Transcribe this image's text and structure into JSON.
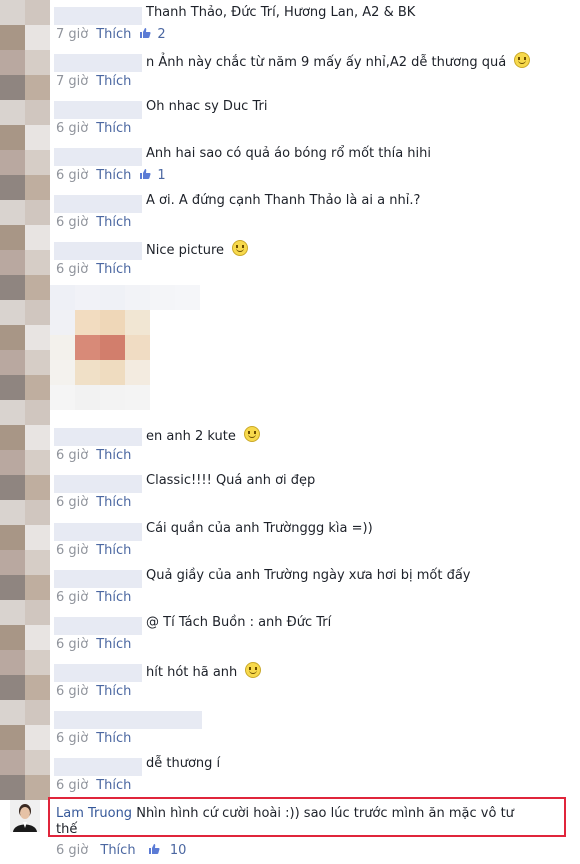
{
  "comments": [
    {
      "text": "Thanh Thảo, Đức Trí, Hương Lan, A2 & BK",
      "time": "7 giờ",
      "like": "Thích",
      "likes": "2"
    },
    {
      "text": "n Ảnh này chắc từ năm 9 mấy ấy nhỉ,A2 dễ thương quá",
      "time": "7 giờ",
      "like": "Thích",
      "likes": ""
    },
    {
      "text": "Oh nhac sy Duc Tri",
      "time": "6 giờ",
      "like": "Thích",
      "likes": ""
    },
    {
      "text": "Anh hai sao có quả áo bóng rổ mốt thía hihi",
      "time": "6 giờ",
      "like": "Thích",
      "likes": "1"
    },
    {
      "text": "A ơi. A đứng cạnh Thanh Thảo là ai a nhỉ.?",
      "time": "6 giờ",
      "like": "Thích",
      "likes": ""
    },
    {
      "text": "Nice picture",
      "time": "6 giờ",
      "like": "Thích",
      "likes": ""
    },
    {
      "text": "en anh 2 kute",
      "time": "6 giờ",
      "like": "Thích",
      "likes": ""
    },
    {
      "text": "Classic!!!! Quá anh ơi đẹp",
      "time": "6 giờ",
      "like": "Thích",
      "likes": ""
    },
    {
      "text": "Cái quần của anh Trườnggg kìa =))",
      "time": "6 giờ",
      "like": "Thích",
      "likes": ""
    },
    {
      "text": "Quả giầy của anh Trường ngày xưa hơi bị mốt đấy",
      "time": "6 giờ",
      "like": "Thích",
      "likes": ""
    },
    {
      "text": "@ Tí Tách Buồn : anh Đức Trí",
      "time": "6 giờ",
      "like": "Thích",
      "likes": ""
    },
    {
      "text": "hít hót hã anh",
      "time": "6 giờ",
      "like": "Thích",
      "likes": ""
    },
    {
      "text": "",
      "time": "6 giờ",
      "like": "Thích",
      "likes": ""
    },
    {
      "text": "dễ thương í",
      "time": "6 giờ",
      "like": "Thích",
      "likes": ""
    }
  ],
  "highlighted": {
    "author": "Lam Truong",
    "text_line1": "Nhìn hình cứ cười hoài :)) sao lúc trước mình ăn mặc vô tư",
    "text_line2": "thế",
    "time": "6 giờ",
    "like": "Thích",
    "likes": "10"
  },
  "colors": {
    "link": "#4b67a1",
    "meta": "#90949c",
    "highlight_border": "#e0253b"
  },
  "icons": [
    "thumbs-up-icon",
    "smile-icon",
    "avatar"
  ]
}
